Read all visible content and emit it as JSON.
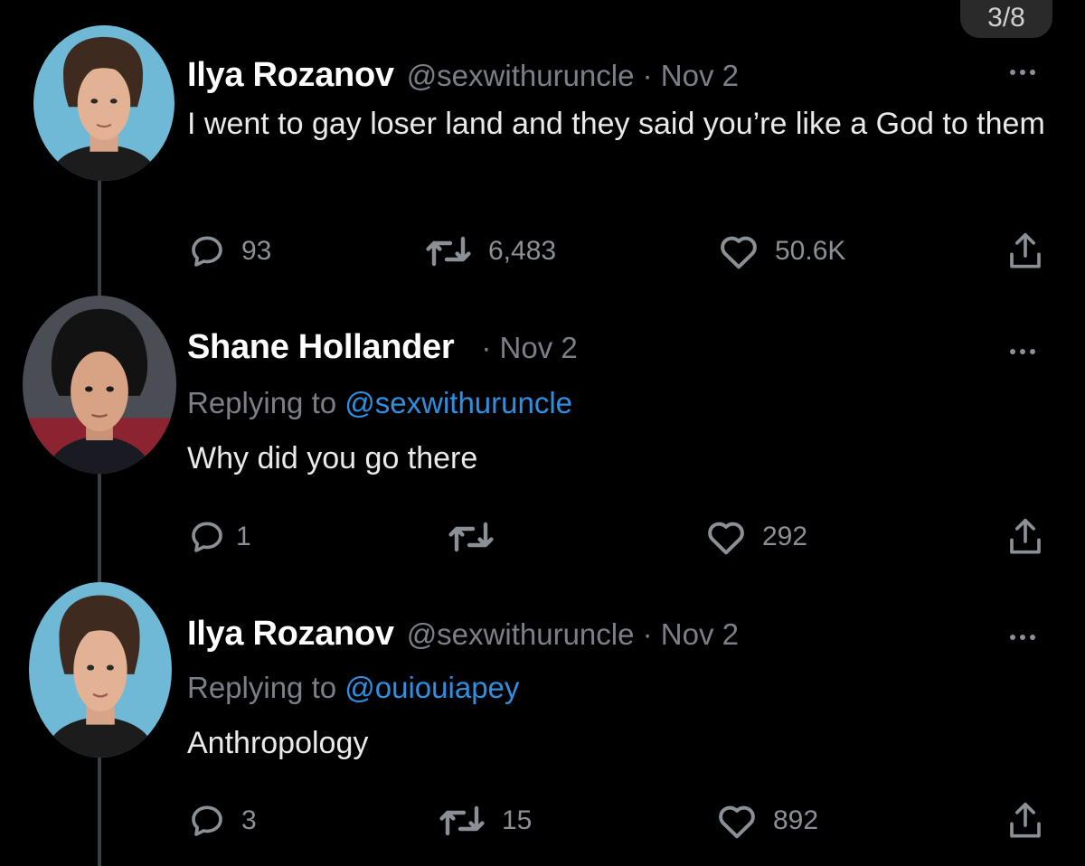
{
  "page_counter": "3/8",
  "tweets": [
    {
      "display_name": "Ilya Rozanov",
      "handle_time": "@sexwithuruncle · Nov 2",
      "replying_label": "",
      "replying_handle": "",
      "text": "I went to gay loser land and they said you’re like a God to them",
      "replies": "93",
      "retweets": "6,483",
      "likes": "50.6K"
    },
    {
      "display_name": "Shane Hollander",
      "handle_time": "· Nov 2",
      "replying_label": "Replying to ",
      "replying_handle": "@sexwithuruncle",
      "text": "Why did you go there",
      "replies": "1",
      "retweets": "",
      "likes": "292"
    },
    {
      "display_name": "Ilya Rozanov",
      "handle_time": "@sexwithuruncle · Nov 2",
      "replying_label": "Replying to ",
      "replying_handle": "@ouiouiapey",
      "text": "Anthropology",
      "replies": "3",
      "retweets": "15",
      "likes": "892"
    }
  ],
  "icons": {
    "reply": "reply-icon",
    "retweet": "retweet-icon",
    "like": "heart-icon",
    "share": "share-icon",
    "more": "more-icon"
  },
  "colors": {
    "background": "#000000",
    "text": "#eaeaea",
    "muted": "#7b8088",
    "mention": "#2f8fe0",
    "ilya_avatar_bg": "#6fb8d6",
    "shane_avatar_bg": "#3a3c44"
  }
}
